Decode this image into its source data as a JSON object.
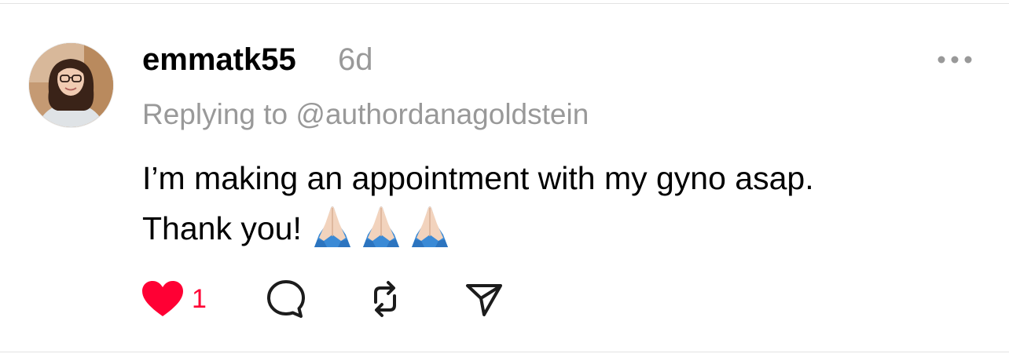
{
  "post": {
    "username": "emmatk55",
    "timestamp": "6d",
    "replying_prefix": "Replying to",
    "replying_handle": "@authordanagoldstein",
    "body_line1": "I’m making an appointment with my gyno asap.",
    "body_line2": "Thank you!",
    "emoji": [
      "folded-hands",
      "folded-hands",
      "folded-hands"
    ]
  },
  "actions": {
    "like_count": "1",
    "liked": true
  },
  "icons": {
    "avatar": "avatar-photo",
    "more": "more-horizontal-icon",
    "like": "heart-icon",
    "reply": "speech-bubble-icon",
    "repost": "repost-icon",
    "share": "send-icon"
  },
  "colors": {
    "like_red": "#ff0034",
    "secondary_text": "#999999",
    "primary_text": "#000000",
    "divider": "#e3e3e3"
  }
}
